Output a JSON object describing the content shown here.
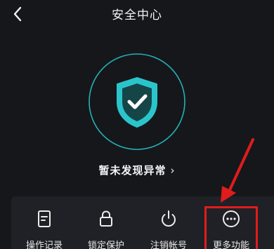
{
  "header": {
    "title": "安全中心",
    "back_icon": "chevron-left-icon"
  },
  "status": {
    "text": "暂未发现异常",
    "chevron": "›",
    "shield_icon": "shield-check-icon",
    "accent_color": "#25c2c9"
  },
  "functions": [
    {
      "label": "操作记录",
      "icon": "document-icon"
    },
    {
      "label": "锁定保护",
      "icon": "lock-icon"
    },
    {
      "label": "注销帐号",
      "icon": "power-icon"
    },
    {
      "label": "更多功能",
      "icon": "more-icon"
    }
  ],
  "annotation": {
    "color": "#e01c1c"
  }
}
